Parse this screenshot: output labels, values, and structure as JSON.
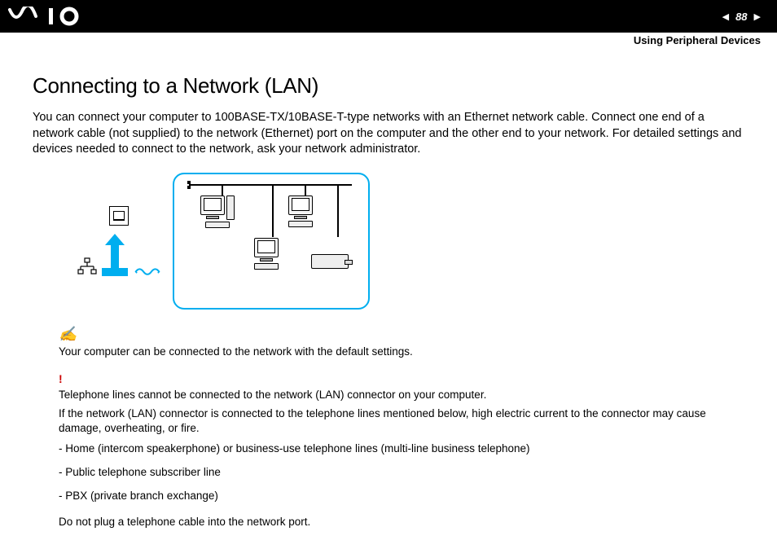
{
  "header": {
    "page_number": "88",
    "section": "Using Peripheral Devices"
  },
  "content": {
    "title": "Connecting to a Network (LAN)",
    "intro": "You can connect your computer to 100BASE-TX/10BASE-T-type networks with an Ethernet network cable. Connect one end of a network cable (not supplied) to the network (Ethernet) port on the computer and the other end to your network. For detailed settings and devices needed to connect to the network, ask your network administrator."
  },
  "notes": {
    "tip": "Your computer can be connected to the network with the default settings.",
    "warning_line1": "Telephone lines cannot be connected to the network (LAN) connector on your computer.",
    "warning_line2": "If the network (LAN) connector is connected to the telephone lines mentioned below, high electric current to the connector may cause damage, overheating, or fire.",
    "bullet1": "- Home (intercom speakerphone) or business-use telephone lines (multi-line business telephone)",
    "bullet2": "- Public telephone subscriber line",
    "bullet3": "- PBX (private branch exchange)",
    "final": "Do not plug a telephone cable into the network port."
  }
}
